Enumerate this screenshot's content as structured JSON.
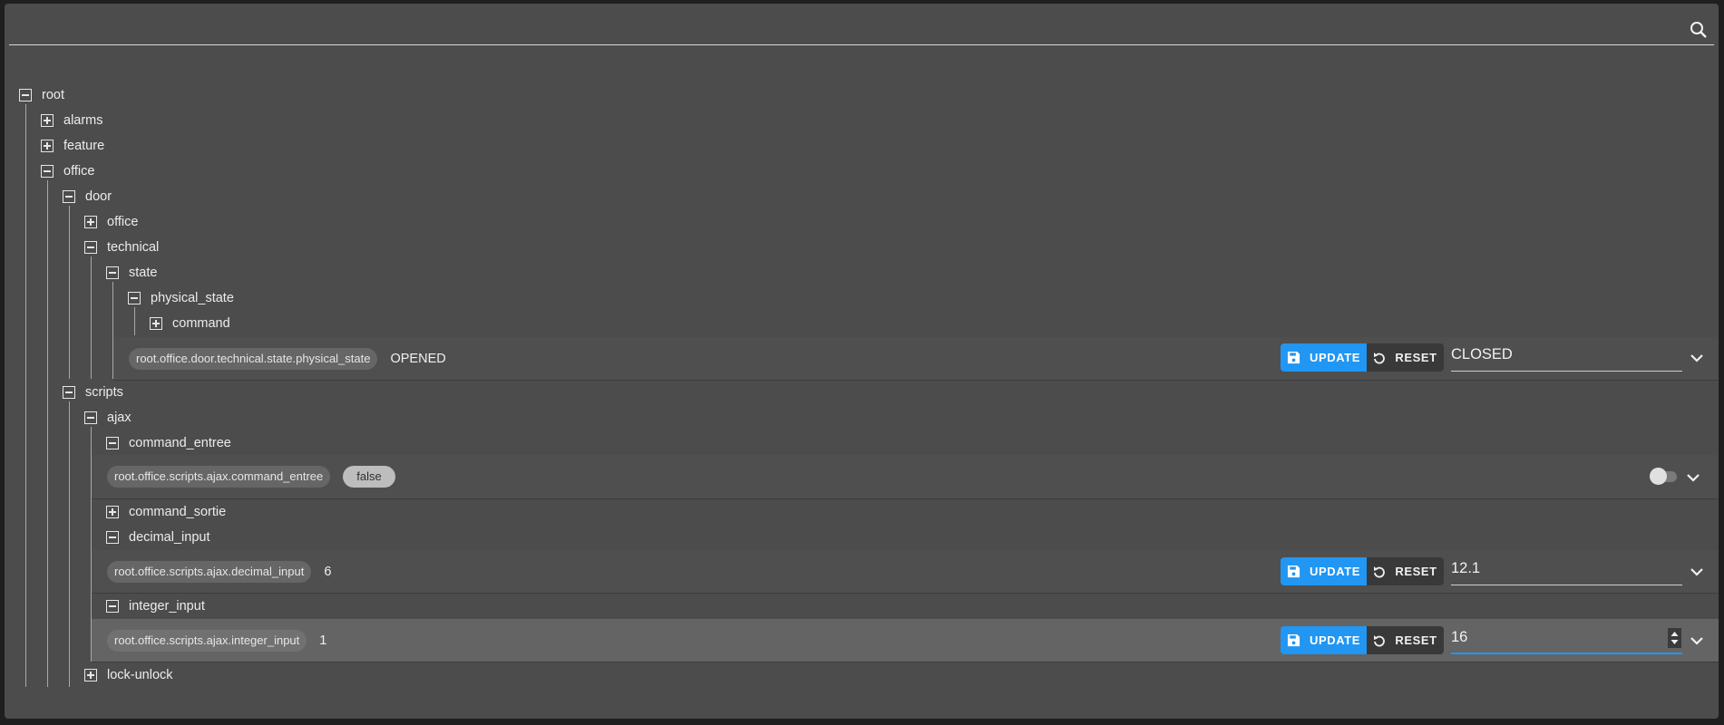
{
  "search": {
    "icon": "search-icon"
  },
  "tree": {
    "root": "root",
    "alarms": "alarms",
    "feature": "feature",
    "office": "office",
    "door": "door",
    "door_office": "office",
    "technical": "technical",
    "state": "state",
    "physical_state": "physical_state",
    "command": "command",
    "scripts": "scripts",
    "ajax": "ajax",
    "command_entree": "command_entree",
    "command_sortie": "command_sortie",
    "decimal_input": "decimal_input",
    "integer_input": "integer_input",
    "lock_unlock": "lock-unlock"
  },
  "rows": {
    "physical_state": {
      "path": "root.office.door.technical.state.physical_state",
      "value": "OPENED",
      "update_label": "UPDATE",
      "reset_label": "RESET",
      "select_value": "CLOSED"
    },
    "command_entree": {
      "path": "root.office.scripts.ajax.command_entree",
      "value": "false",
      "switch_on": false
    },
    "decimal_input": {
      "path": "root.office.scripts.ajax.decimal_input",
      "value": "6",
      "update_label": "UPDATE",
      "reset_label": "RESET",
      "input_value": "12.1"
    },
    "integer_input": {
      "path": "root.office.scripts.ajax.integer_input",
      "value": "1",
      "update_label": "UPDATE",
      "reset_label": "RESET",
      "input_value": "16"
    }
  },
  "colors": {
    "accent": "#2196f3",
    "card": "#4c4c4c",
    "background": "#1f1f1f"
  }
}
